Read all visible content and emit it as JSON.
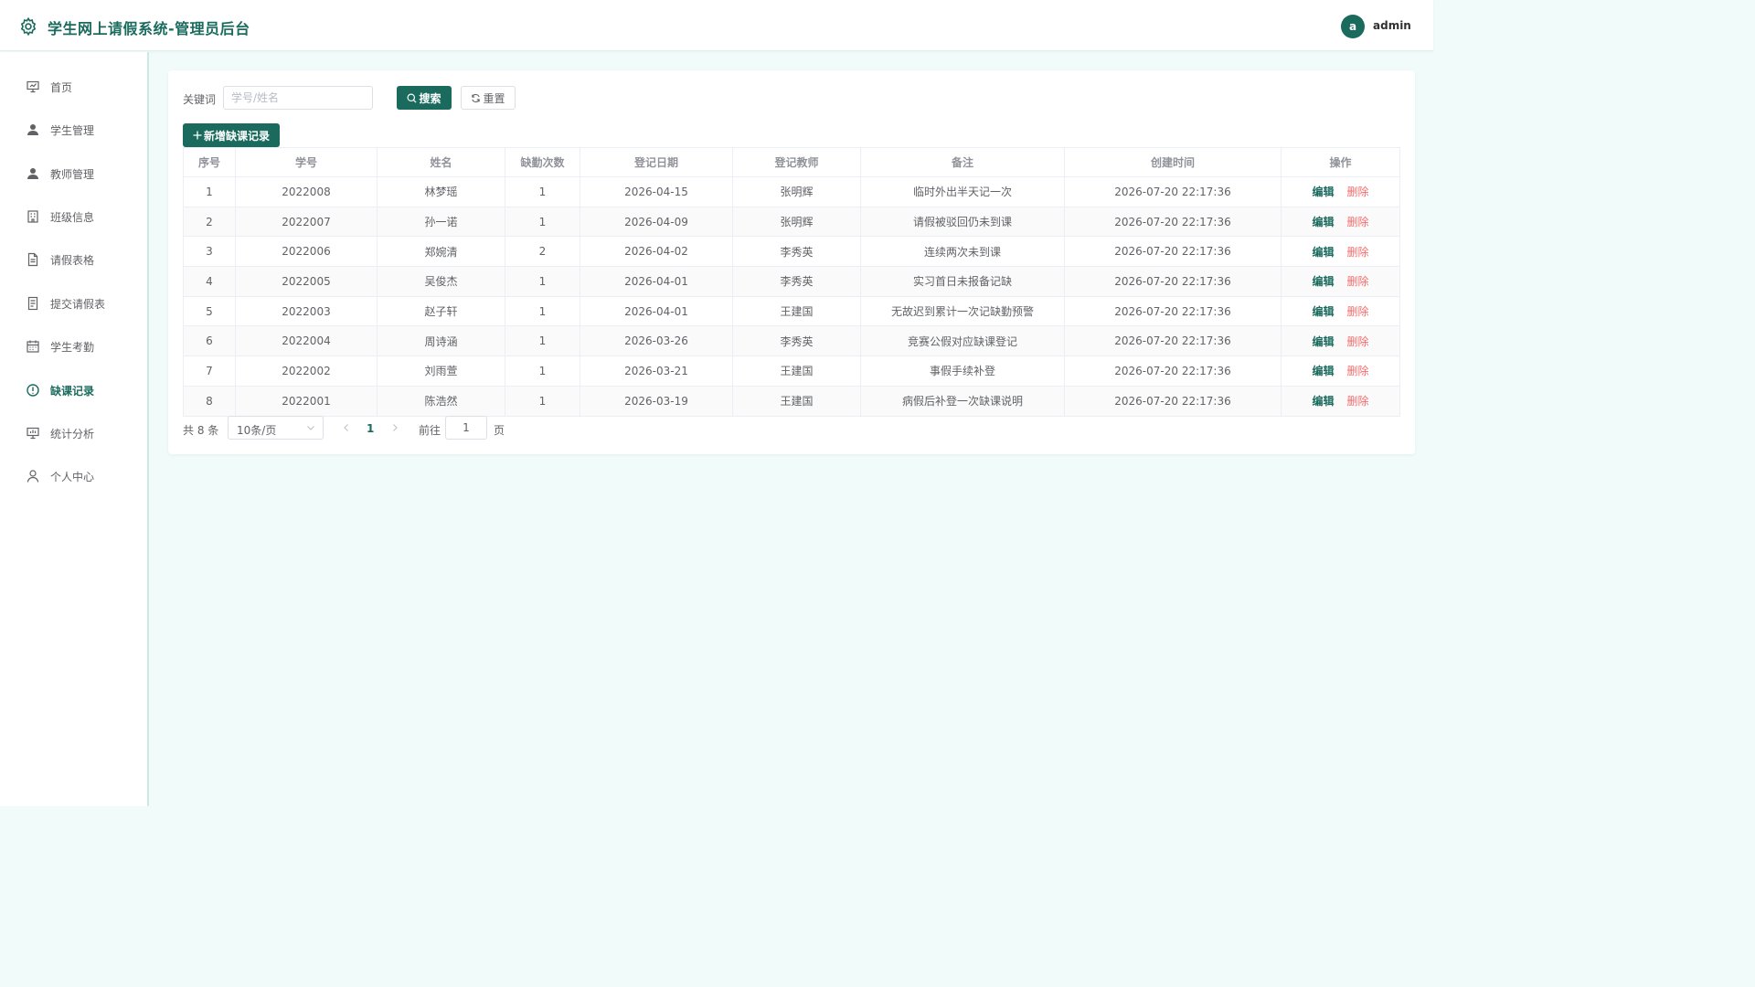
{
  "header": {
    "title": "学生网上请假系统-管理员后台",
    "avatar_letter": "a",
    "username": "admin"
  },
  "sidebar": {
    "items": [
      {
        "label": "首页",
        "icon": "presentation-icon"
      },
      {
        "label": "学生管理",
        "icon": "user-icon"
      },
      {
        "label": "教师管理",
        "icon": "user-icon"
      },
      {
        "label": "班级信息",
        "icon": "building-icon"
      },
      {
        "label": "请假表格",
        "icon": "document-icon"
      },
      {
        "label": "提交请假表",
        "icon": "document-icon"
      },
      {
        "label": "学生考勤",
        "icon": "calendar-icon"
      },
      {
        "label": "缺课记录",
        "icon": "warning-circle-icon",
        "active": true
      },
      {
        "label": "统计分析",
        "icon": "presentation-icon"
      },
      {
        "label": "个人中心",
        "icon": "user-outline-icon"
      }
    ]
  },
  "search": {
    "label": "关键词",
    "placeholder": "学号/姓名",
    "search_btn": "搜索",
    "reset_btn": "重置",
    "add_btn": "新增缺课记录"
  },
  "table": {
    "columns": [
      "序号",
      "学号",
      "姓名",
      "缺勤次数",
      "登记日期",
      "登记教师",
      "备注",
      "创建时间",
      "操作"
    ],
    "rows": [
      [
        "1",
        "2022008",
        "林梦瑶",
        "1",
        "2026-04-15",
        "张明辉",
        "临时外出半天记一次",
        "2026-07-20 22:17:36"
      ],
      [
        "2",
        "2022007",
        "孙一诺",
        "1",
        "2026-04-09",
        "张明辉",
        "请假被驳回仍未到课",
        "2026-07-20 22:17:36"
      ],
      [
        "3",
        "2022006",
        "郑婉清",
        "2",
        "2026-04-02",
        "李秀英",
        "连续两次未到课",
        "2026-07-20 22:17:36"
      ],
      [
        "4",
        "2022005",
        "吴俊杰",
        "1",
        "2026-04-01",
        "李秀英",
        "实习首日未报备记缺",
        "2026-07-20 22:17:36"
      ],
      [
        "5",
        "2022003",
        "赵子轩",
        "1",
        "2026-04-01",
        "王建国",
        "无故迟到累计一次记缺勤预警",
        "2026-07-20 22:17:36"
      ],
      [
        "6",
        "2022004",
        "周诗涵",
        "1",
        "2026-03-26",
        "李秀英",
        "竞赛公假对应缺课登记",
        "2026-07-20 22:17:36"
      ],
      [
        "7",
        "2022002",
        "刘雨萱",
        "1",
        "2026-03-21",
        "王建国",
        "事假手续补登",
        "2026-07-20 22:17:36"
      ],
      [
        "8",
        "2022001",
        "陈浩然",
        "1",
        "2026-03-19",
        "王建国",
        "病假后补登一次缺课说明",
        "2026-07-20 22:17:36"
      ]
    ],
    "edit_label": "编辑",
    "delete_label": "删除"
  },
  "pagination": {
    "total": "共 8 条",
    "page_size": "10条/页",
    "current_page": "1",
    "goto_label": "前往",
    "goto_value": "1",
    "page_suffix": "页"
  },
  "colors": {
    "primary": "#1a6b5e",
    "danger": "#f56c6c",
    "background": "#f1fbf9"
  }
}
